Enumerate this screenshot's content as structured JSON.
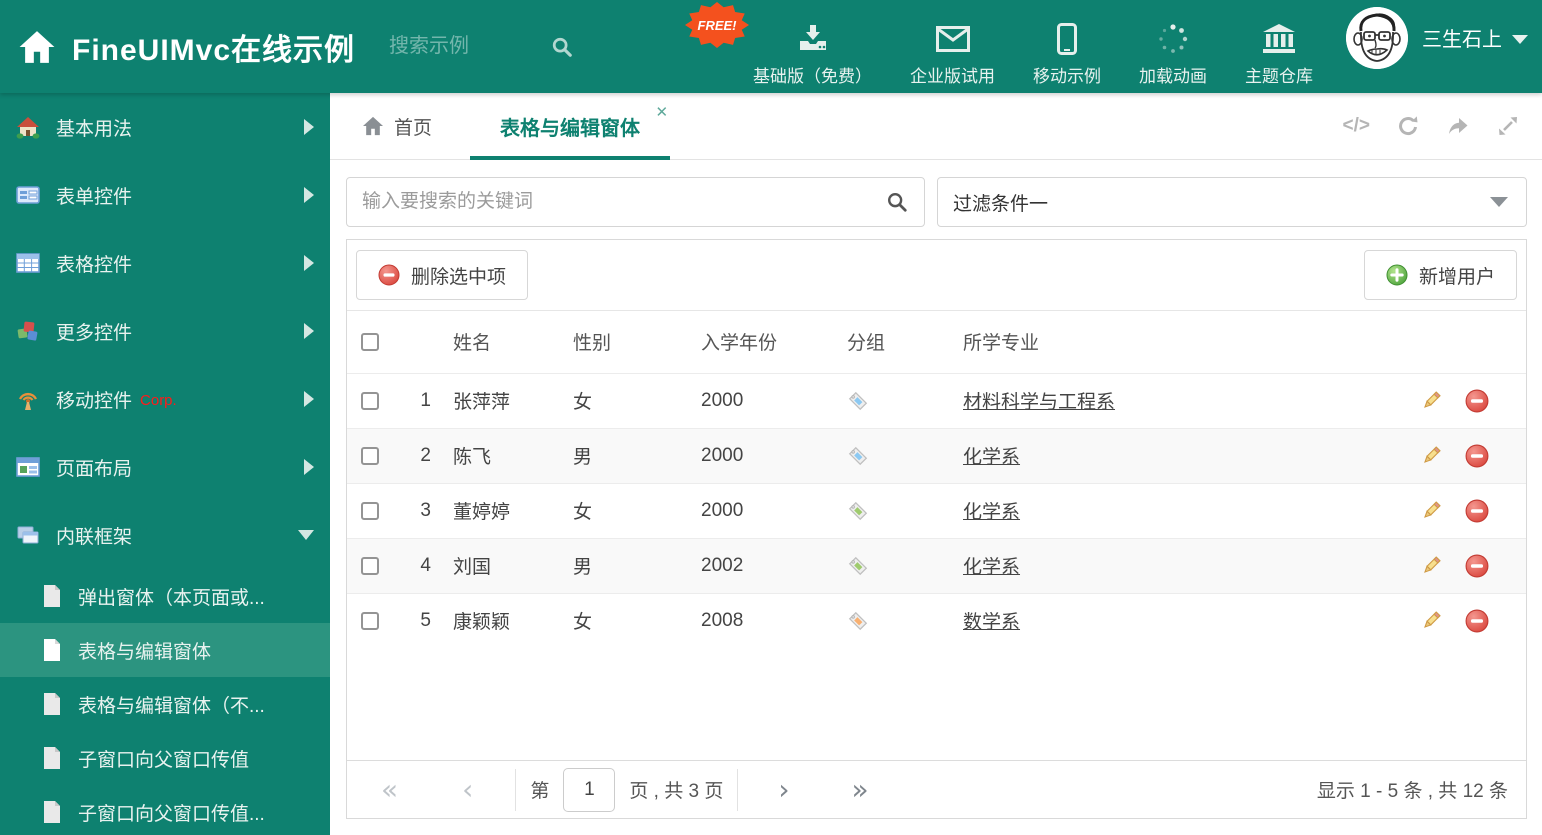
{
  "header": {
    "title": "FineUIMvc在线示例",
    "search_placeholder": "搜索示例",
    "free_badge": "FREE!",
    "nav": [
      {
        "label": "基础版（免费）",
        "icon": "download-icon"
      },
      {
        "label": "企业版试用",
        "icon": "envelope-icon"
      },
      {
        "label": "移动示例",
        "icon": "phone-icon"
      },
      {
        "label": "加载动画",
        "icon": "spinner-icon"
      },
      {
        "label": "主题仓库",
        "icon": "bank-icon"
      }
    ],
    "username": "三生石上"
  },
  "sidebar": {
    "items": [
      {
        "label": "基本用法",
        "icon": "home-icon",
        "state": "collapsed"
      },
      {
        "label": "表单控件",
        "icon": "form-icon",
        "state": "collapsed"
      },
      {
        "label": "表格控件",
        "icon": "grid-icon",
        "state": "collapsed"
      },
      {
        "label": "更多控件",
        "icon": "cubes-icon",
        "state": "collapsed"
      },
      {
        "label": "移动控件",
        "badge": "Corp.",
        "icon": "antenna-icon",
        "state": "collapsed"
      },
      {
        "label": "页面布局",
        "icon": "layout-icon",
        "state": "collapsed"
      },
      {
        "label": "内联框架",
        "icon": "frames-icon",
        "state": "expanded"
      }
    ],
    "subitems": [
      {
        "label": "弹出窗体（本页面或...",
        "active": false
      },
      {
        "label": "表格与编辑窗体",
        "active": true
      },
      {
        "label": "表格与编辑窗体（不...",
        "active": false
      },
      {
        "label": "子窗口向父窗口传值",
        "active": false
      },
      {
        "label": "子窗口向父窗口传值...",
        "active": false
      }
    ]
  },
  "tabs": [
    {
      "label": "首页",
      "active": false
    },
    {
      "label": "表格与编辑窗体",
      "active": true,
      "closable": true
    }
  ],
  "filters": {
    "search_placeholder": "输入要搜索的关键词",
    "filter_value": "过滤条件一"
  },
  "toolbar": {
    "delete_label": "删除选中项",
    "add_label": "新增用户"
  },
  "table": {
    "columns": [
      "姓名",
      "性别",
      "入学年份",
      "分组",
      "所学专业"
    ],
    "rows": [
      {
        "index": "1",
        "name": "张萍萍",
        "gender": "女",
        "year": "2000",
        "tag_color": "#8CC9F2",
        "major": "材料科学与工程系"
      },
      {
        "index": "2",
        "name": "陈飞",
        "gender": "男",
        "year": "2000",
        "tag_color": "#8CC9F2",
        "major": "化学系"
      },
      {
        "index": "3",
        "name": "董婷婷",
        "gender": "女",
        "year": "2000",
        "tag_color": "#9FCB6E",
        "major": "化学系"
      },
      {
        "index": "4",
        "name": "刘国",
        "gender": "男",
        "year": "2002",
        "tag_color": "#9FCB6E",
        "major": "化学系"
      },
      {
        "index": "5",
        "name": "康颖颖",
        "gender": "女",
        "year": "2008",
        "tag_color": "#F8B071",
        "major": "数学系"
      }
    ]
  },
  "pagination": {
    "first_icon": "«",
    "prev_icon": "‹",
    "page_prefix": "第",
    "page": "1",
    "page_suffix": "页 , 共 3 页",
    "next_icon": "›",
    "last_icon": "»",
    "summary": "显示 1 - 5 条 , 共 12 条"
  },
  "icons": {
    "code_tool_text": "</>"
  },
  "colors": {
    "accent_teal": "#0E8170",
    "sidebar_active": "#2C9480",
    "badge_orange": "#F4511E",
    "delete_red": "#D9534F",
    "add_green": "#5CB85C"
  }
}
